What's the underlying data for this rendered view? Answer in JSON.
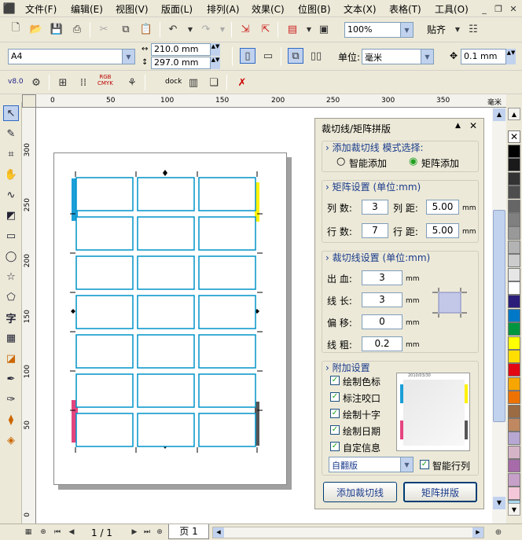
{
  "menu": {
    "items": [
      "文件(F)",
      "编辑(E)",
      "视图(V)",
      "版面(L)",
      "排列(A)",
      "效果(C)",
      "位图(B)",
      "文本(X)",
      "表格(T)",
      "工具(O)"
    ]
  },
  "toolbar1": {
    "zoom_value": "100%",
    "snap_label": "贴齐"
  },
  "toolbar2": {
    "paper_size": "A4",
    "width": "210.0 mm",
    "height": "297.0 mm",
    "unit_label": "单位:",
    "unit_value": "毫米",
    "nudge_value": "0.1 mm"
  },
  "toolbar3": {
    "version": "v8.0",
    "dock_label": "dock",
    "rgb_label": "RGB",
    "cmyk_label": "CMYK"
  },
  "ruler": {
    "h_ticks": [
      "0",
      "50",
      "100",
      "150",
      "200",
      "250",
      "300",
      "350",
      "400",
      "450",
      "毫米"
    ],
    "v_ticks": [
      "300",
      "250",
      "200",
      "150",
      "100",
      "50",
      "0"
    ]
  },
  "docker": {
    "title": "裁切线/矩阵拼版",
    "add_group": {
      "title": "添加裁切线 模式选择:",
      "radio_smart": "智能添加",
      "radio_matrix": "矩阵添加"
    },
    "matrix_group": {
      "title": "矩阵设置 (单位:mm)",
      "cols_label": "列 数:",
      "cols_value": "3",
      "col_spacing_label": "列 距:",
      "col_spacing_value": "5.00",
      "rows_label": "行 数:",
      "rows_value": "7",
      "row_spacing_label": "行 距:",
      "row_spacing_value": "5.00",
      "unit": "mm"
    },
    "crop_group": {
      "title": "裁切线设置 (单位:mm)",
      "bleed_label": "出 血:",
      "bleed_value": "3",
      "length_label": "线 长:",
      "length_value": "3",
      "offset_label": "偏 移:",
      "offset_value": "0",
      "thickness_label": "线 粗:",
      "thickness_value": "0.2",
      "unit": "mm"
    },
    "extra_group": {
      "title": "附加设置",
      "options": [
        "绘制色标",
        "标注咬口",
        "绘制十字",
        "绘制日期",
        "自定信息"
      ],
      "preset_value": "自翻版",
      "smart_arrange_label": "智能行列",
      "preview_date": "2010/03/30"
    },
    "add_crop_button": "添加裁切线",
    "matrix_button": "矩阵拼版"
  },
  "status": {
    "page_counter": "1 / 1",
    "page_tab": "页 1"
  },
  "palette": [
    "#ffffff",
    "#000000",
    "#1a1a1a",
    "#333333",
    "#4d4d4d",
    "#666666",
    "#808080",
    "#999999",
    "#b3b3b3",
    "#cccccc",
    "#e6e6e6",
    "#ffffff",
    "#2b1e7a",
    "#0078c8",
    "#009640",
    "#ffff00",
    "#ffde00",
    "#e30613",
    "#f7a600",
    "#ee7203",
    "#9b6b43",
    "#c08860",
    "#b7a7d3",
    "#d6b4c8",
    "#a66ba8",
    "#c6a0c8",
    "#f4c8d8",
    "#a9d8f0"
  ]
}
